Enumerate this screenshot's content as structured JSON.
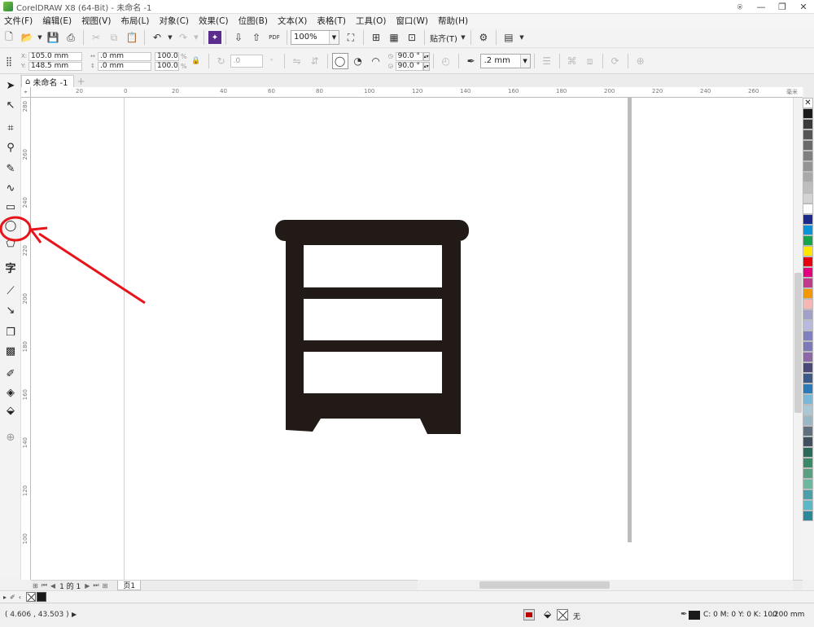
{
  "window": {
    "title": "CorelDRAW X8 (64-Bit) - 未命名 -1"
  },
  "menu": [
    "文件(F)",
    "编辑(E)",
    "视图(V)",
    "布局(L)",
    "对象(C)",
    "效果(C)",
    "位图(B)",
    "文本(X)",
    "表格(T)",
    "工具(O)",
    "窗口(W)",
    "帮助(H)"
  ],
  "toolbar": {
    "zoom": "100%",
    "snap_label": "贴齐(T)",
    "pdf_label": "PDF"
  },
  "property_bar": {
    "x": "105.0 mm",
    "y": "148.5 mm",
    "width": ".0 mm",
    "height": ".0 mm",
    "scale_w": "100.0",
    "scale_h": "100.0",
    "rotation": ".0",
    "start_angle": "90.0 °",
    "end_angle": "90.0 °",
    "outline_width": ".2 mm",
    "pct": "%"
  },
  "document": {
    "tab": "未命名 -1",
    "ruler_unit": "毫米"
  },
  "ruler_h_labels": [
    "20",
    "0",
    "20",
    "40",
    "60",
    "80",
    "100",
    "120",
    "140",
    "160",
    "180",
    "200",
    "220",
    "240",
    "260"
  ],
  "ruler_v_labels": [
    "280",
    "260",
    "240",
    "220",
    "200",
    "180",
    "160",
    "140",
    "120",
    "100",
    "80",
    "60"
  ],
  "page_nav": {
    "current": "1 的 1",
    "page_tab": "页1"
  },
  "status": {
    "coords": "( 4.606 , 43.503 )",
    "fill_text": "无",
    "outline_text": "C: 0 M: 0 Y: 0 K: 100",
    "outline_width": ".200 mm"
  },
  "palette_colors": [
    "#1a1a1a",
    "#3a3a3a",
    "#555555",
    "#6a6a6a",
    "#7f7f7f",
    "#949494",
    "#a9a9a9",
    "#bebebe",
    "#d3d3d3",
    "#ffffff",
    "#1b2a8c",
    "#0b93d8",
    "#16a34a",
    "#ffe600",
    "#e60012",
    "#e4007f",
    "#c0398a",
    "#f39800",
    "#f7b6b6",
    "#a0a0c8",
    "#b9b9e0",
    "#8080c0",
    "#7a7ab8",
    "#8c68a8",
    "#4a4a7a",
    "#3a5a8a",
    "#2a7ab8",
    "#7ab8d8",
    "#a8c8d8",
    "#98b8c8",
    "#607080",
    "#405060",
    "#2a6a5a",
    "#3a8a6a",
    "#5aa080",
    "#6ab8a0",
    "#4aa0a8",
    "#5ab8c8",
    "#2a8898"
  ]
}
